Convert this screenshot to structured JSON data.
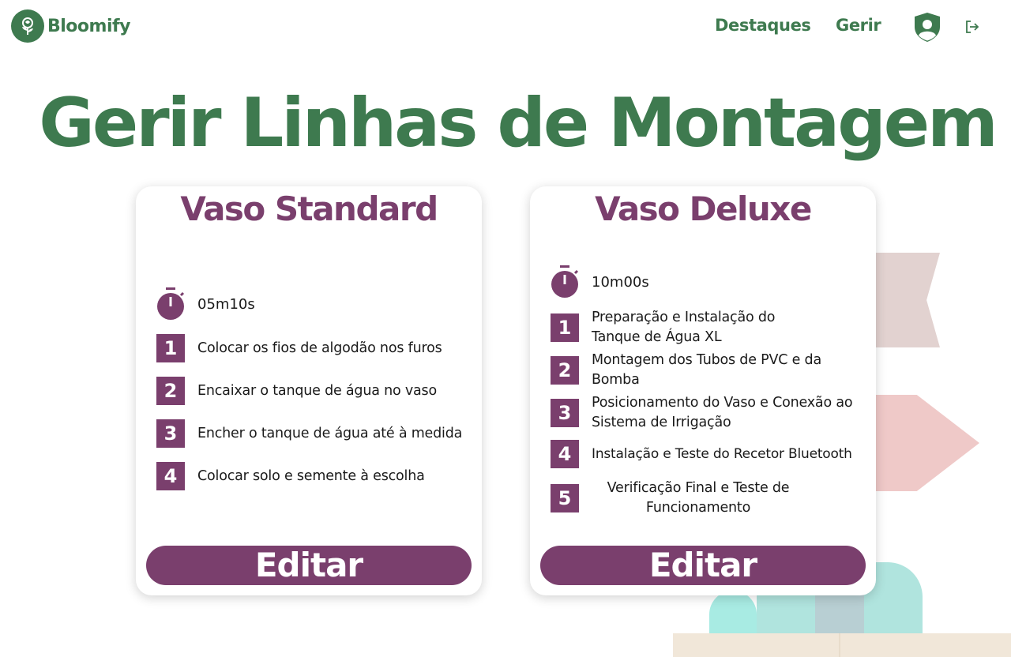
{
  "brand": {
    "name": "Bloomify",
    "color": "#3e7a4f",
    "logo_icon": "rose-icon"
  },
  "nav": {
    "highlights": "Destaques",
    "manage": "Gerir",
    "profile_icon": "user-shield-icon",
    "logout_icon": "logout-icon"
  },
  "page_title": "Gerir Linhas de Montagem",
  "accent_color": "#7a3f6d",
  "cards": [
    {
      "title": "Vaso Standard",
      "time": "05m10s",
      "steps": [
        {
          "num": "1",
          "text": "Colocar os fios de algodão nos furos"
        },
        {
          "num": "2",
          "text": "Encaixar o tanque de água no vaso"
        },
        {
          "num": "3",
          "text": "Encher o tanque de água até à medida"
        },
        {
          "num": "4",
          "text": "Colocar solo e semente à escolha"
        }
      ],
      "button": "Editar"
    },
    {
      "title": "Vaso Deluxe",
      "time": "10m00s",
      "steps": [
        {
          "num": "1",
          "text": "Preparação e Instalação do Tanque de Água XL"
        },
        {
          "num": "2",
          "text": "Montagem dos Tubos de PVC e da Bomba"
        },
        {
          "num": "3",
          "text": "Posicionamento do Vaso e Conexão ao Sistema de Irrigação"
        },
        {
          "num": "4",
          "text": "Instalação e Teste do Recetor Bluetooth"
        },
        {
          "num": "5",
          "text": "Verificação Final e Teste de Funcionamento"
        }
      ],
      "button": "Editar"
    }
  ]
}
